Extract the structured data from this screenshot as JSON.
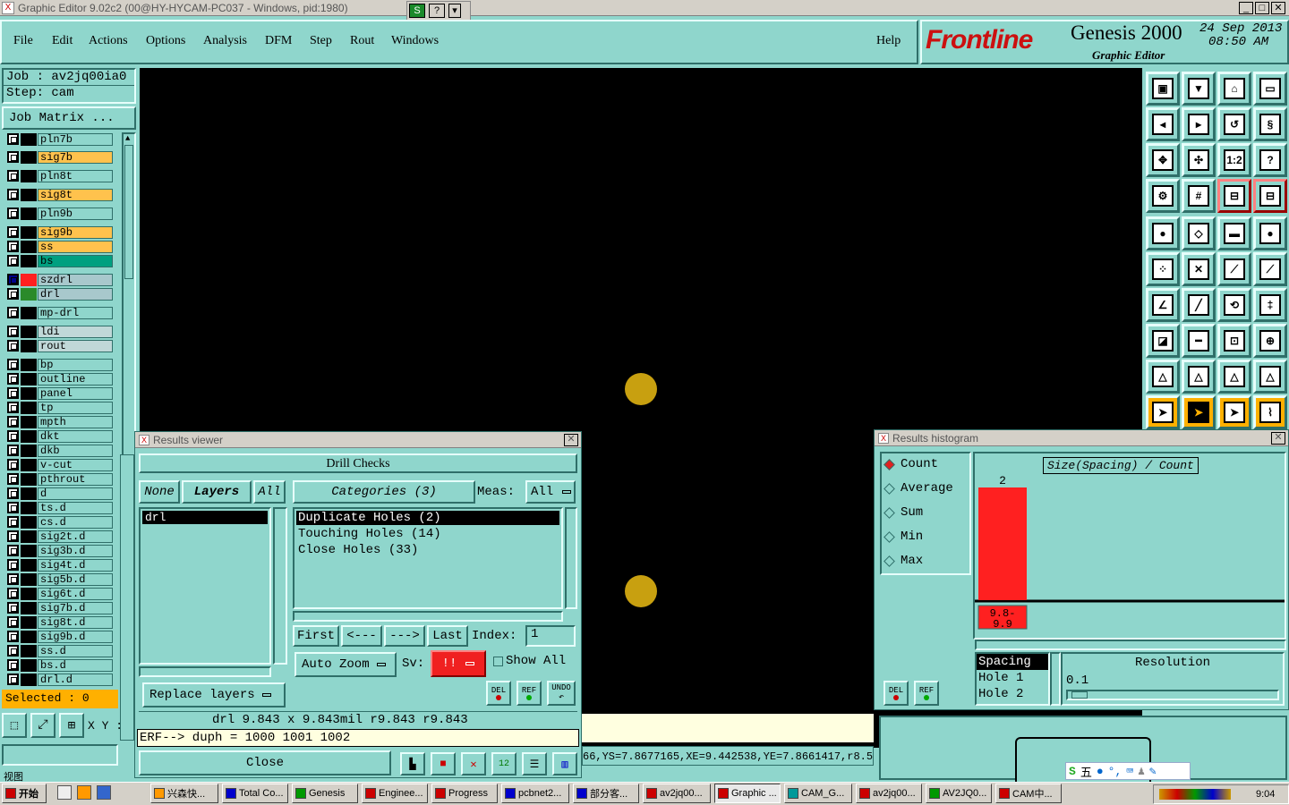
{
  "window_title": "Graphic Editor 9.02c2 (00@HY-HYCAM-PC037 - Windows, pid:1980)",
  "menu": [
    "File",
    "Edit",
    "Actions",
    "Options",
    "Analysis",
    "DFM",
    "Step",
    "Rout",
    "Windows"
  ],
  "help_label": "Help",
  "brand": {
    "logo": "Frontline",
    "product": "Genesis 2000",
    "subtitle": "Graphic Editor",
    "date": "24 Sep 2013",
    "time": "08:50 AM"
  },
  "job": {
    "job_label": "Job : av2jq00ia0",
    "step_label": "Step: cam",
    "matrix_button": "Job Matrix ..."
  },
  "layers": [
    {
      "name": "pln7b",
      "color": "#8fd6cc"
    },
    {
      "name": "sig7b",
      "color": "#ffc24d"
    },
    {
      "name": "pln8t",
      "color": "#8fd6cc"
    },
    {
      "name": "sig8t",
      "color": "#ffc24d"
    },
    {
      "name": "pln9b",
      "color": "#8fd6cc"
    },
    {
      "name": "sig9b",
      "color": "#ffc24d"
    },
    {
      "name": "ss",
      "color": "#ffc24d"
    },
    {
      "name": "bs",
      "color": "#00a080"
    },
    {
      "name": "szdrl",
      "color": "#a8c8cc"
    },
    {
      "name": "drl",
      "color": "#a8c8cc"
    },
    {
      "name": "mp-drl",
      "color": "#8fd6cc"
    },
    {
      "name": "ldi",
      "color": "#c0d8d8"
    },
    {
      "name": "rout",
      "color": "#c0d8d8"
    },
    {
      "name": "bp",
      "color": "#8fd6cc"
    },
    {
      "name": "outline",
      "color": "#8fd6cc"
    },
    {
      "name": "panel",
      "color": "#8fd6cc"
    },
    {
      "name": "tp",
      "color": "#8fd6cc"
    },
    {
      "name": "mpth",
      "color": "#8fd6cc"
    },
    {
      "name": "dkt",
      "color": "#8fd6cc"
    },
    {
      "name": "dkb",
      "color": "#8fd6cc"
    },
    {
      "name": "v-cut",
      "color": "#8fd6cc"
    },
    {
      "name": "pthrout",
      "color": "#8fd6cc"
    },
    {
      "name": "d",
      "color": "#8fd6cc"
    },
    {
      "name": "ts.d",
      "color": "#8fd6cc"
    },
    {
      "name": "cs.d",
      "color": "#8fd6cc"
    },
    {
      "name": "sig2t.d",
      "color": "#8fd6cc"
    },
    {
      "name": "sig3b.d",
      "color": "#8fd6cc"
    },
    {
      "name": "sig4t.d",
      "color": "#8fd6cc"
    },
    {
      "name": "sig5b.d",
      "color": "#8fd6cc"
    },
    {
      "name": "sig6t.d",
      "color": "#8fd6cc"
    },
    {
      "name": "sig7b.d",
      "color": "#8fd6cc"
    },
    {
      "name": "sig8t.d",
      "color": "#8fd6cc"
    },
    {
      "name": "sig9b.d",
      "color": "#8fd6cc"
    },
    {
      "name": "ss.d",
      "color": "#8fd6cc"
    },
    {
      "name": "bs.d",
      "color": "#8fd6cc"
    },
    {
      "name": "drl.d",
      "color": "#8fd6cc"
    }
  ],
  "selected_label": "Selected : 0",
  "xy_label": "X Y :",
  "results_viewer": {
    "title": "Results viewer",
    "header": "Drill Checks",
    "none": "None",
    "layers": "Layers",
    "all": "All",
    "categories": "Categories (3)",
    "meas_label": "Meas:",
    "meas_value": "All",
    "layer_items": [
      "drl"
    ],
    "category_items": [
      "Duplicate Holes (2)",
      "Touching Holes (14)",
      "Close Holes (33)"
    ],
    "first": "First",
    "prev": "<---",
    "next": "--->",
    "last": "Last",
    "index_label": "Index:",
    "index_value": "1",
    "auto_zoom": "Auto Zoom",
    "sv_label": "Sv:",
    "sv_value": "!!",
    "show_all": "Show All",
    "replace_layers": "Replace layers",
    "del": "DEL",
    "ref": "REF",
    "undo": "UNDO",
    "measure_line": "drl 9.843 x 9.843mil   r9.843   r9.843",
    "erf_line": "ERF--> duph = 1000 1001 1002",
    "close": "Close"
  },
  "status_line": "66,YS=7.8677165,XE=9.442538,YE=7.8661417,r8.5,I",
  "histogram": {
    "title": "Results histogram",
    "options": [
      "Count",
      "Average",
      "Sum",
      "Min",
      "Max"
    ],
    "selected_option": "Count",
    "chart_title": "Size(Spacing) / Count",
    "del": "DEL",
    "ref": "REF",
    "list_items": [
      "Spacing",
      "Hole 1",
      "Hole 2"
    ],
    "resolution_label": "Resolution",
    "resolution_value": "0.1"
  },
  "chart_data": {
    "type": "bar",
    "title": "Size(Spacing) / Count",
    "categories": [
      "9.8-9.9"
    ],
    "values": [
      2
    ],
    "series": [
      {
        "values": [
          2
        ],
        "color": "#ff2020"
      }
    ]
  },
  "taskbar": {
    "start": "开始",
    "items": [
      "兴森快...",
      "Total Co...",
      "Genesis",
      "Enginee...",
      "Progress",
      "pcbnet2...",
      "部分客...",
      "av2jq00...",
      "Graphic ...",
      "CAM_G...",
      "av2jq00...",
      "AV2JQ0...",
      "CAM中..."
    ],
    "clock": "9:04"
  },
  "ime_label": "五"
}
